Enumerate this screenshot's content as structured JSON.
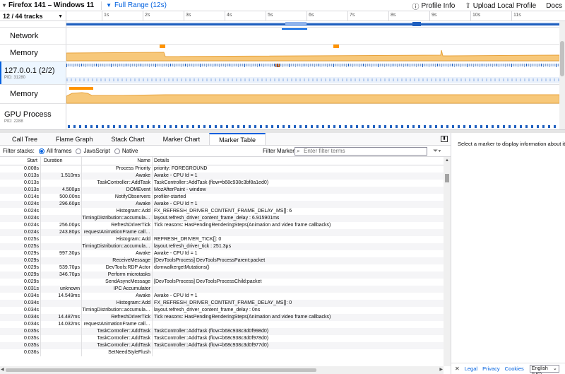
{
  "toolbar": {
    "profile_name": "Firefox 141 – Windows 11",
    "range_label": "Full Range (12s)",
    "profile_info": "Profile Info",
    "upload": "Upload Local Profile",
    "docs": "Docs"
  },
  "timeline": {
    "track_count": "12 / 44 tracks",
    "ticks": [
      "1s",
      "2s",
      "3s",
      "4s",
      "5s",
      "6s",
      "7s",
      "8s",
      "9s",
      "10s",
      "11s"
    ],
    "tracks": [
      {
        "label": "Network"
      },
      {
        "label": "Memory"
      },
      {
        "label": "127.0.0.1 (2/2)",
        "pid": "PID: 31280"
      },
      {
        "label": "Memory"
      },
      {
        "label": "GPU Process",
        "pid": "PID: 2288"
      }
    ],
    "colors": {
      "memory": "#f7c87a",
      "memory_stroke": "#e8a33c",
      "accent": "#0060df",
      "marker_blue": "#1f5fbf",
      "marker_orange": "#ff9400"
    }
  },
  "panel": {
    "tabs": [
      "Call Tree",
      "Flame Graph",
      "Stack Chart",
      "Marker Chart",
      "Marker Table"
    ],
    "active_tab": "Marker Table",
    "filter_stacks_label": "Filter stacks:",
    "filter_options": [
      "All frames",
      "JavaScript",
      "Native"
    ],
    "selected_filter": "All frames",
    "filter_markers_label": "Filter Markers:",
    "filter_placeholder": "Enter filter terms"
  },
  "table": {
    "headers": {
      "start": "Start",
      "duration": "Duration",
      "name": "Name",
      "details": "Details"
    },
    "rows": [
      {
        "start": "0.008s",
        "duration": "",
        "name": "Process Priority",
        "details": "priority: FOREGROUND"
      },
      {
        "start": "0.013s",
        "duration": "1.510ms",
        "name": "Awake",
        "details": "Awake - CPU Id = 1"
      },
      {
        "start": "0.013s",
        "duration": "",
        "name": "TaskController::AddTask",
        "details": "TaskController::AddTask (flow=b68c938c3bf8a1ed0)"
      },
      {
        "start": "0.013s",
        "duration": "4.500μs",
        "name": "DOMEvent",
        "details": "MozAfterPaint - window"
      },
      {
        "start": "0.014s",
        "duration": "500.00ns",
        "name": "NotifyObservers",
        "details": "profiler-started"
      },
      {
        "start": "0.024s",
        "duration": "296.60μs",
        "name": "Awake",
        "details": "Awake - CPU Id = 1"
      },
      {
        "start": "0.024s",
        "duration": "",
        "name": "Histogram::Add",
        "details": "FX_REFRESH_DRIVER_CONTENT_FRAME_DELAY_MS[]: 6"
      },
      {
        "start": "0.024s",
        "duration": "",
        "name": "TimingDistribution::accumula…",
        "details": "layout.refresh_driver_content_frame_delay : 6.915901ms"
      },
      {
        "start": "0.024s",
        "duration": "256.00μs",
        "name": "RefreshDriverTick",
        "details": "Tick reasons: HasPendingRenderingSteps(Animation and video frame callbacks)"
      },
      {
        "start": "0.024s",
        "duration": "243.80μs",
        "name": "requestAnimationFrame call…",
        "details": ""
      },
      {
        "start": "0.025s",
        "duration": "",
        "name": "Histogram::Add",
        "details": "REFRESH_DRIVER_TICK[]: 0"
      },
      {
        "start": "0.025s",
        "duration": "",
        "name": "TimingDistribution::accumula…",
        "details": "layout.refresh_driver_tick : 251.3μs"
      },
      {
        "start": "0.029s",
        "duration": "997.30μs",
        "name": "Awake",
        "details": "Awake - CPU Id = 1"
      },
      {
        "start": "0.029s",
        "duration": "",
        "name": "ReceiveMessage",
        "details": "[DevToolsProcess] DevToolsProcessParent:packet"
      },
      {
        "start": "0.029s",
        "duration": "539.70μs",
        "name": "DevTools:RDP Actor",
        "details": "domwalkergetMutations()"
      },
      {
        "start": "0.029s",
        "duration": "346.70μs",
        "name": "Perform microtasks",
        "details": ""
      },
      {
        "start": "0.029s",
        "duration": "",
        "name": "SendAsyncMessage",
        "details": "[DevToolsProcess] DevToolsProcessChild:packet"
      },
      {
        "start": "0.031s",
        "duration": "unknown",
        "name": "IPC Accumulator",
        "details": ""
      },
      {
        "start": "0.034s",
        "duration": "14.549ms",
        "name": "Awake",
        "details": "Awake - CPU Id = 1"
      },
      {
        "start": "0.034s",
        "duration": "",
        "name": "Histogram::Add",
        "details": "FX_REFRESH_DRIVER_CONTENT_FRAME_DELAY_MS[]: 0"
      },
      {
        "start": "0.034s",
        "duration": "",
        "name": "TimingDistribution::accumula…",
        "details": "layout.refresh_driver_content_frame_delay : 0ns"
      },
      {
        "start": "0.034s",
        "duration": "14.487ms",
        "name": "RefreshDriverTick",
        "details": "Tick reasons: HasPendingRenderingSteps(Animation and video frame callbacks)"
      },
      {
        "start": "0.034s",
        "duration": "14.032ms",
        "name": "requestAnimationFrame call…",
        "details": ""
      },
      {
        "start": "0.035s",
        "duration": "",
        "name": "TaskController::AddTask",
        "details": "TaskController::AddTask (flow=b68c938c3d0f998d0)"
      },
      {
        "start": "0.035s",
        "duration": "",
        "name": "TaskController::AddTask",
        "details": "TaskController::AddTask (flow=b68c938c3d0f978d0)"
      },
      {
        "start": "0.035s",
        "duration": "",
        "name": "TaskController::AddTask",
        "details": "TaskController::AddTask (flow=b68c938c3d0f977d0)"
      },
      {
        "start": "0.036s",
        "duration": "",
        "name": "SetNeedStyleFlush",
        "details": ""
      }
    ]
  },
  "sidebar": {
    "message": "Select a marker to display information about it.",
    "footer_links": [
      "Legal",
      "Privacy",
      "Cookies"
    ],
    "language": "English (US)"
  }
}
